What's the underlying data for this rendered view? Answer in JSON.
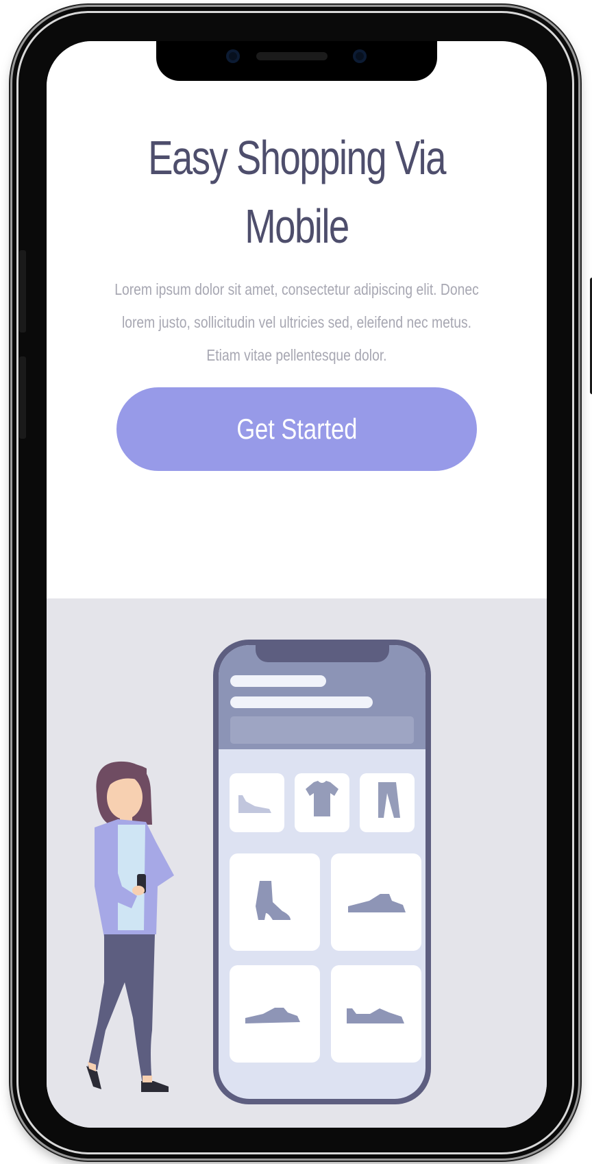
{
  "hero": {
    "title_line1": "Easy Shopping Via",
    "title_line2": "Mobile",
    "description": "Lorem ipsum dolor sit amet, consectetur adipiscing elit. Donec lorem justo, sollicitudin vel ultricies sed, eleifend nec metus. Etiam vitae pellentesque dolor.",
    "cta_label": "Get Started"
  },
  "colors": {
    "title": "#4e4e6c",
    "text_muted": "#a7a7b2",
    "cta_background": "#979ae8",
    "illustration_background": "#e4e4ea"
  },
  "illustration": {
    "icons": [
      "shoe-icon",
      "tshirt-icon",
      "pants-icon",
      "boot-icon",
      "sneaker-icon",
      "sneaker-icon",
      "sneaker-icon"
    ]
  }
}
